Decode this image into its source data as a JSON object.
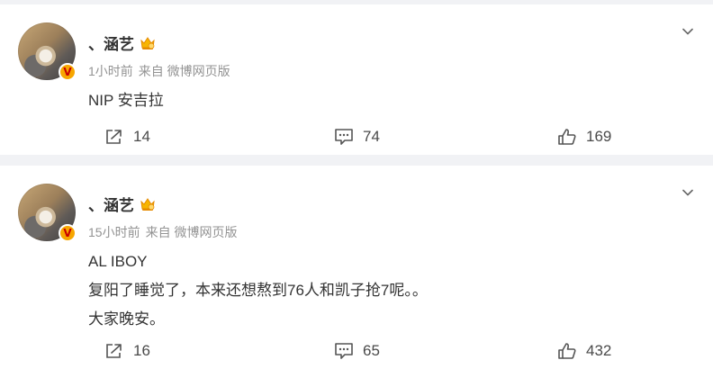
{
  "posts": [
    {
      "author": "、涵艺",
      "time": "1小时前",
      "source": "来自 微博网页版",
      "lines": [
        "NIP 安吉拉"
      ],
      "reposts": "14",
      "comments": "74",
      "likes": "169",
      "verified_badge": "V"
    },
    {
      "author": "、涵艺",
      "time": "15小时前",
      "source": "来自 微博网页版",
      "lines": [
        "AL IBOY",
        "复阳了睡觉了，本来还想熬到76人和凯子抢7呢。。",
        "大家晚安。"
      ],
      "reposts": "16",
      "comments": "65",
      "likes": "432",
      "verified_badge": "V"
    }
  ],
  "icons": {
    "repost": "repost-icon",
    "comment": "comment-icon",
    "like": "like-icon",
    "more": "chevron-down-icon",
    "vip": "crown-icon"
  },
  "colors": {
    "background": "#f1f2f5",
    "card": "#ffffff",
    "text": "#333333",
    "meta": "#939393",
    "badge": "#f7a600"
  }
}
